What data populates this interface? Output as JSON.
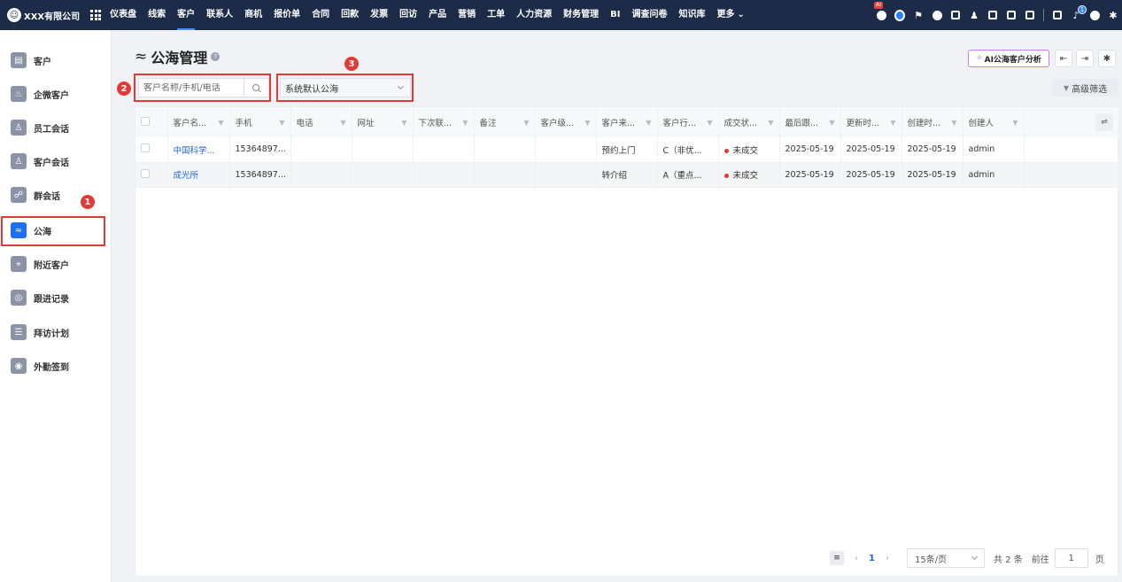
{
  "topbar": {
    "company": "XXX有限公司",
    "nav": [
      "仪表盘",
      "线索",
      "客户",
      "联系人",
      "商机",
      "报价单",
      "合同",
      "回款",
      "发票",
      "回访",
      "产品",
      "营销",
      "工单",
      "人力资源",
      "财务管理",
      "BI",
      "调查问卷",
      "知识库"
    ],
    "active_nav": "客户",
    "more": "更多",
    "ai_badge": "AI",
    "notification_count": "1",
    "icons": [
      "robot-icon",
      "chat-icon",
      "flag-icon",
      "globe-icon",
      "check-icon",
      "user-icon",
      "doc-icon",
      "phone-icon",
      "calendar-icon",
      "report-icon",
      "bell-icon",
      "help-icon",
      "settings-icon"
    ]
  },
  "sidebar": {
    "items": [
      {
        "label": "客户",
        "icon": "folder-icon"
      },
      {
        "label": "企微客户",
        "icon": "wecom-icon"
      },
      {
        "label": "员工会话",
        "icon": "user-chat-icon"
      },
      {
        "label": "客户会话",
        "icon": "customer-chat-icon"
      },
      {
        "label": "群会话",
        "icon": "group-icon"
      },
      {
        "label": "公海",
        "icon": "waves-icon"
      },
      {
        "label": "附近客户",
        "icon": "location-icon"
      },
      {
        "label": "跟进记录",
        "icon": "follow-icon"
      },
      {
        "label": "拜访计划",
        "icon": "plan-icon"
      },
      {
        "label": "外勤签到",
        "icon": "checkin-icon"
      }
    ],
    "active": "公海"
  },
  "main": {
    "title": "公海管理",
    "ai_button": "AI公海客户分析",
    "search_placeholder": "客户名称/手机/电话",
    "select_value": "系统默认公海",
    "advanced_filter": "高级筛选"
  },
  "annotations": [
    "1",
    "2",
    "3"
  ],
  "table": {
    "columns": [
      "客户名...",
      "手机",
      "电话",
      "网址",
      "下次联...",
      "备注",
      "客户级...",
      "客户来...",
      "客户行...",
      "成交状...",
      "最后跟...",
      "更新时...",
      "创建时...",
      "创建人"
    ],
    "rows": [
      [
        "中国科学...",
        "15364897...",
        "",
        "",
        "",
        "",
        "",
        "预约上门",
        "C（非优...",
        "未成交",
        "2025-05-19",
        "2025-05-19",
        "2025-05-19",
        "admin"
      ],
      [
        "成光所",
        "15364897...",
        "",
        "",
        "",
        "",
        "",
        "转介绍",
        "A（重点...",
        "未成交",
        "2025-05-19",
        "2025-05-19",
        "2025-05-19",
        "admin"
      ]
    ]
  },
  "pagination": {
    "current": "1",
    "page_size": "15条/页",
    "total": "共 2 条",
    "goto_label": "前往",
    "goto_value": "1",
    "unit": "页"
  },
  "colors": {
    "topbar": "#1b2b48",
    "accent": "#1f6ff2",
    "annotation": "#e53935",
    "link": "#1f63d8"
  }
}
